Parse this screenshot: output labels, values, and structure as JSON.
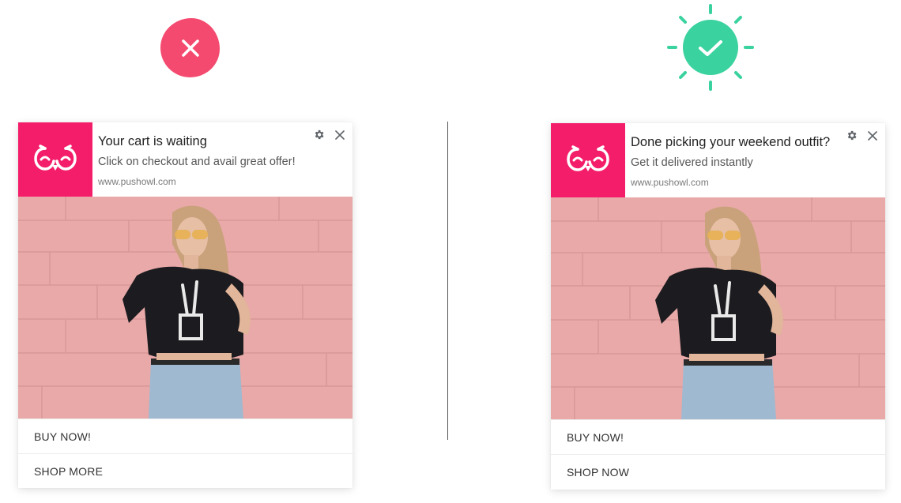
{
  "colors": {
    "bad": "#f54a6f",
    "good": "#3ad29f",
    "brand": "#f41d6a",
    "wall": "#e8a9a8"
  },
  "badges": {
    "bad_icon": "close-x-icon",
    "good_icon": "checkmark-icon"
  },
  "left_notification": {
    "title": "Your cart is waiting",
    "body": "Click on checkout and avail great offer!",
    "domain": "www.pushowl.com",
    "actions": [
      "BUY NOW!",
      "SHOP MORE"
    ]
  },
  "right_notification": {
    "title": "Done picking your weekend outfit?",
    "body": "Get it delivered instantly",
    "domain": "www.pushowl.com",
    "actions": [
      "BUY NOW!",
      "SHOP NOW"
    ]
  }
}
